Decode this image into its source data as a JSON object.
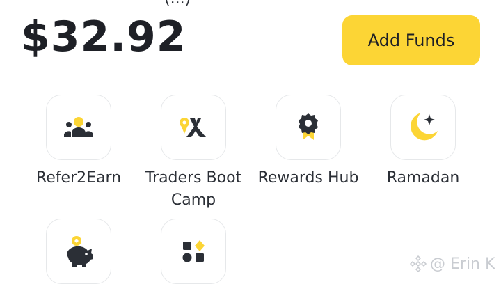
{
  "header": {
    "cut_text": "(...)"
  },
  "balance": {
    "amount": "$32.92"
  },
  "actions": {
    "add_funds_label": "Add Funds"
  },
  "colors": {
    "accent": "#fcd535",
    "icon_dark": "#2b2f36"
  },
  "shortcuts": [
    {
      "label": "Refer2Earn",
      "icon": "group-icon"
    },
    {
      "label": "Traders Boot Camp",
      "icon": "camp-tent-icon"
    },
    {
      "label": "Rewards Hub",
      "icon": "reward-badge-icon"
    },
    {
      "label": "Ramadan",
      "icon": "crescent-moon-icon"
    },
    {
      "label": "",
      "icon": "piggy-bank-icon"
    },
    {
      "label": "",
      "icon": "more-apps-icon"
    }
  ],
  "watermark": {
    "text": "@ Erin K"
  }
}
